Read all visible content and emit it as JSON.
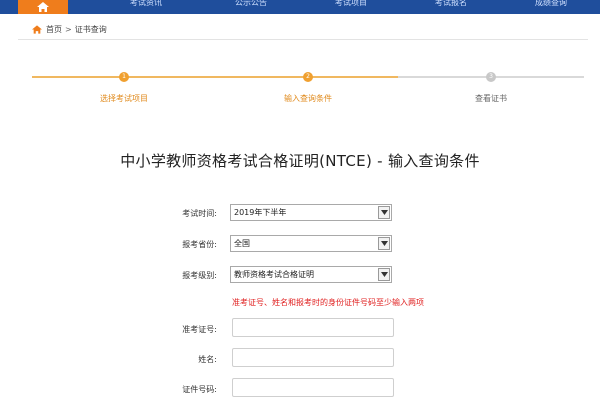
{
  "nav": {
    "items": [
      "考试资讯",
      "公示公告",
      "考试项目",
      "考试报名",
      "成绩查询"
    ]
  },
  "breadcrumb": {
    "home": "首页",
    "separator": ">",
    "current": "证书查询"
  },
  "stepper": {
    "steps": [
      {
        "number": "1",
        "label": "选择考试项目",
        "state": "done"
      },
      {
        "number": "2",
        "label": "输入查询条件",
        "state": "active"
      },
      {
        "number": "3",
        "label": "查看证书",
        "state": "pending"
      }
    ]
  },
  "title": "中小学教师资格考试合格证明(NTCE) - 输入查询条件",
  "form": {
    "exam_time": {
      "label": "考试时间:",
      "value": "2019年下半年"
    },
    "province": {
      "label": "报考省份:",
      "value": "全国"
    },
    "level": {
      "label": "报考级别:",
      "value": "教师资格考试合格证明"
    },
    "hint": "准考证号、姓名和报考时的身份证件号码至少输入两项",
    "admission_no": {
      "label": "准考证号:",
      "value": ""
    },
    "name": {
      "label": "姓名:",
      "value": ""
    },
    "id_no": {
      "label": "证件号码:",
      "value": ""
    }
  },
  "colors": {
    "nav_bg": "#1f4e9c",
    "accent": "#ef7d1c",
    "hint": "#e02020"
  }
}
